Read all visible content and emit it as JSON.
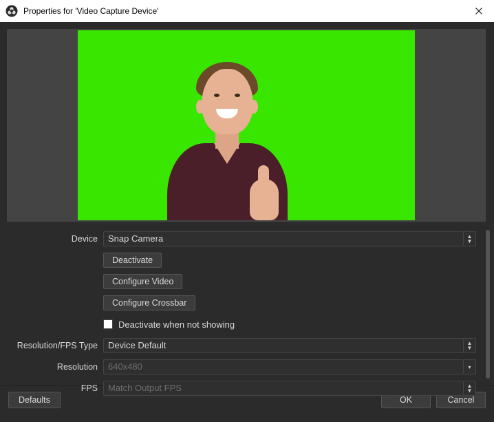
{
  "window": {
    "title": "Properties for 'Video Capture Device'"
  },
  "form": {
    "device_label": "Device",
    "device_value": "Snap Camera",
    "deactivate_btn": "Deactivate",
    "configure_video_btn": "Configure Video",
    "configure_crossbar_btn": "Configure Crossbar",
    "deactivate_checkbox_label": "Deactivate when not showing",
    "resfps_label": "Resolution/FPS Type",
    "resfps_value": "Device Default",
    "resolution_label": "Resolution",
    "resolution_placeholder": "640x480",
    "fps_label": "FPS",
    "fps_placeholder": "Match Output FPS"
  },
  "footer": {
    "defaults": "Defaults",
    "ok": "OK",
    "cancel": "Cancel"
  }
}
